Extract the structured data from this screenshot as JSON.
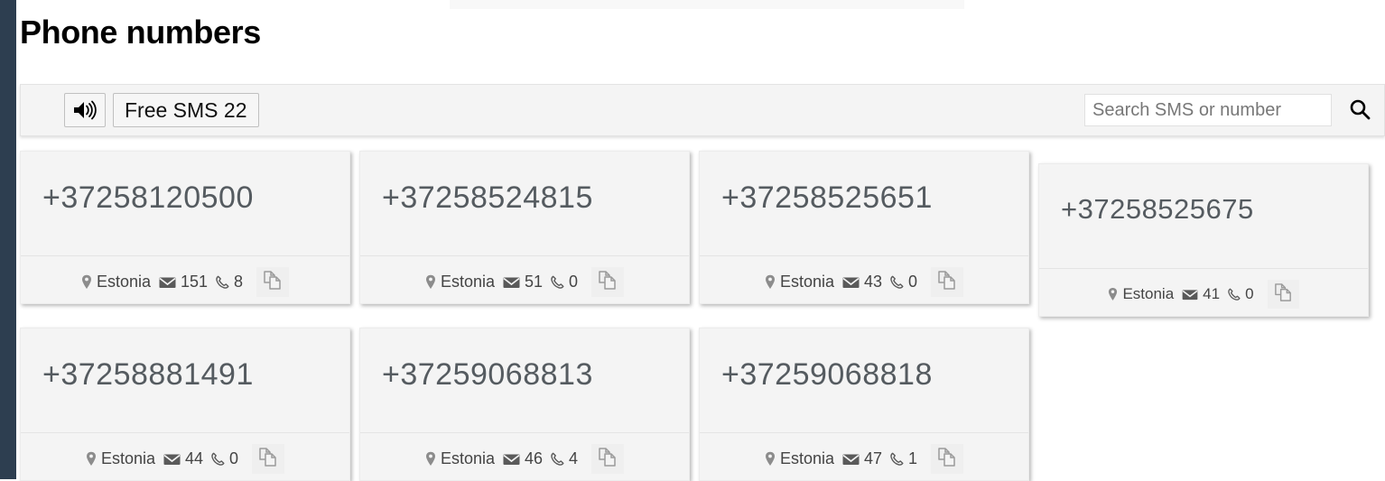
{
  "page": {
    "title": "Phone numbers",
    "background_color": "#ffffff",
    "rail_color": "#2d3e50"
  },
  "toolbar": {
    "speaker_button": {
      "icon": "speaker-volume-icon",
      "label": ""
    },
    "free_sms_button_label": "Free SMS 22",
    "search": {
      "placeholder": "Search SMS or number",
      "value": "",
      "icon": "search-icon"
    }
  },
  "cards": [
    {
      "number": "+37258120500",
      "country": "Estonia",
      "sms_count": "151",
      "call_count": "8",
      "copy_icon": "copy-icon",
      "location_icon": "map-pin-icon",
      "sms_icon": "envelope-icon",
      "call_icon": "phone-handset-icon"
    },
    {
      "number": "+37258524815",
      "country": "Estonia",
      "sms_count": "51",
      "call_count": "0",
      "copy_icon": "copy-icon",
      "location_icon": "map-pin-icon",
      "sms_icon": "envelope-icon",
      "call_icon": "phone-handset-icon"
    },
    {
      "number": "+37258525651",
      "country": "Estonia",
      "sms_count": "43",
      "call_count": "0",
      "copy_icon": "copy-icon",
      "location_icon": "map-pin-icon",
      "sms_icon": "envelope-icon",
      "call_icon": "phone-handset-icon"
    },
    {
      "number": "+37258525675",
      "country": "Estonia",
      "sms_count": "41",
      "call_count": "0",
      "copy_icon": "copy-icon",
      "location_icon": "map-pin-icon",
      "sms_icon": "envelope-icon",
      "call_icon": "phone-handset-icon"
    },
    {
      "number": "+37258881491",
      "country": "Estonia",
      "sms_count": "44",
      "call_count": "0",
      "copy_icon": "copy-icon",
      "location_icon": "map-pin-icon",
      "sms_icon": "envelope-icon",
      "call_icon": "phone-handset-icon"
    },
    {
      "number": "+37259068813",
      "country": "Estonia",
      "sms_count": "46",
      "call_count": "4",
      "copy_icon": "copy-icon",
      "location_icon": "map-pin-icon",
      "sms_icon": "envelope-icon",
      "call_icon": "phone-handset-icon"
    },
    {
      "number": "+37259068818",
      "country": "Estonia",
      "sms_count": "47",
      "call_count": "1",
      "copy_icon": "copy-icon",
      "location_icon": "map-pin-icon",
      "sms_icon": "envelope-icon",
      "call_icon": "phone-handset-icon"
    }
  ]
}
